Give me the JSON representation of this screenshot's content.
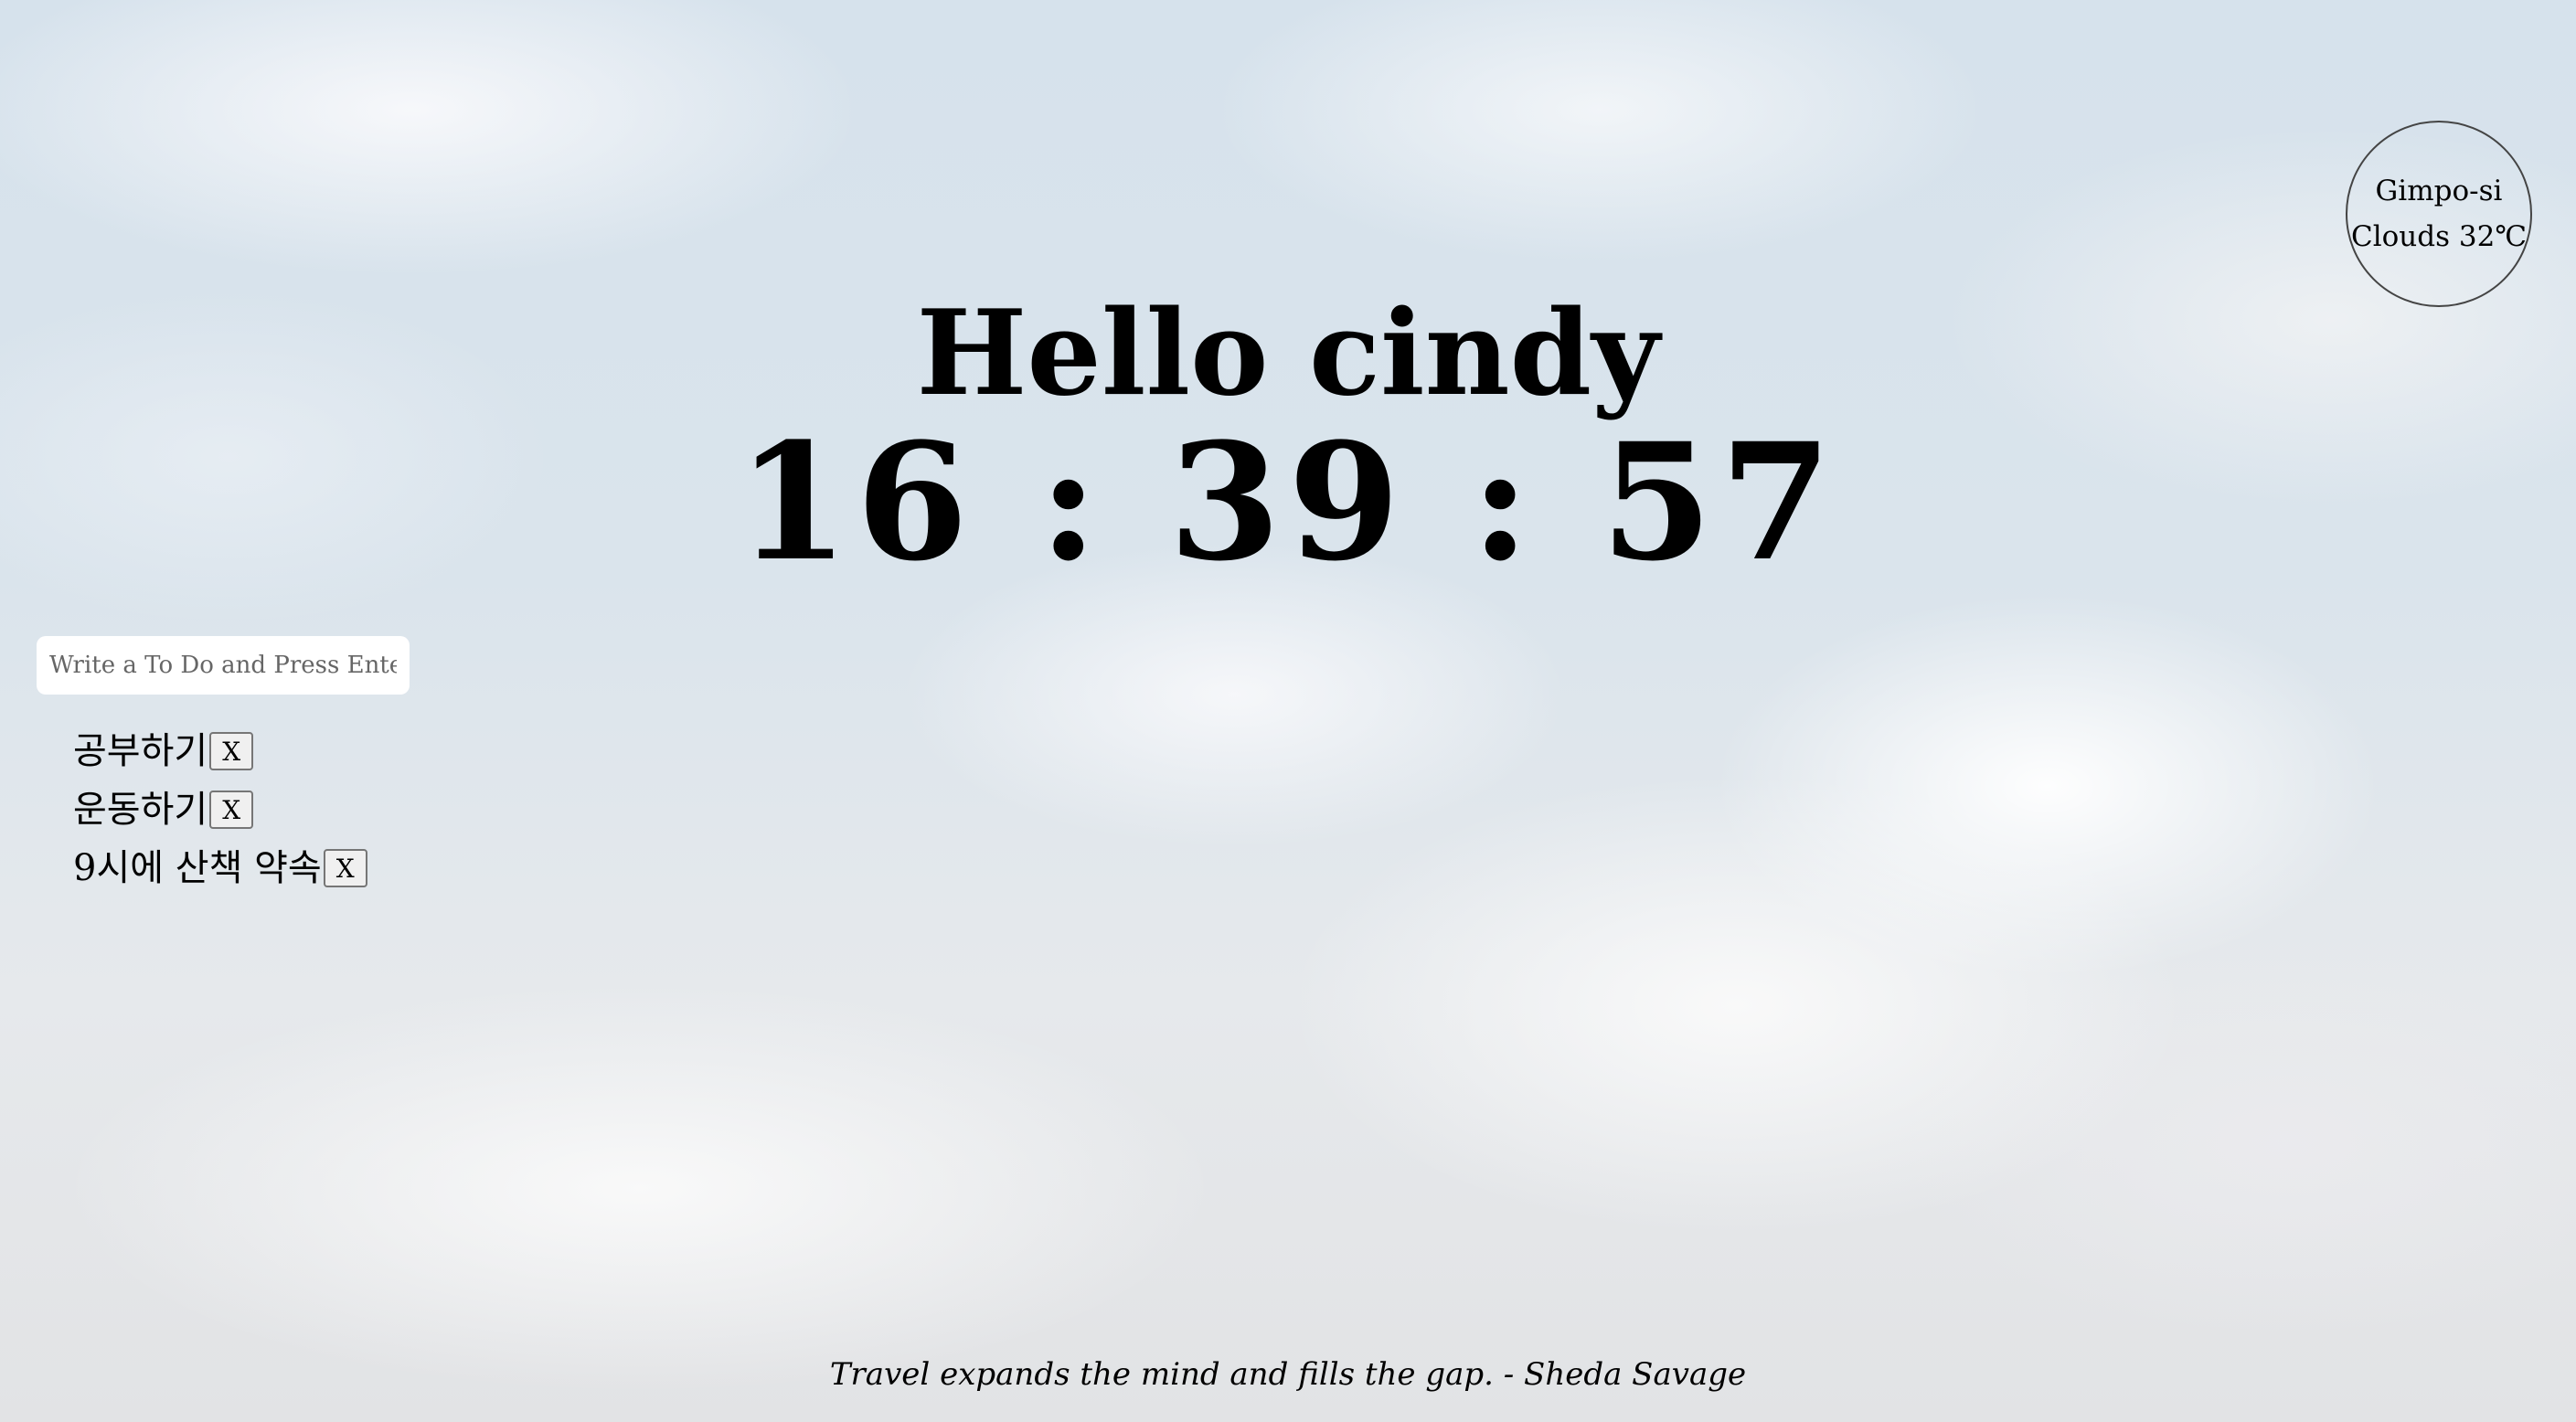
{
  "weather": {
    "city": "Gimpo-si",
    "condition": "Clouds 32℃"
  },
  "greeting": "Hello cindy",
  "clock": "16 : 39 : 57",
  "todo": {
    "placeholder": "Write a To Do and Press Enter",
    "items": [
      {
        "text": "공부하기",
        "delete_label": "X"
      },
      {
        "text": "운동하기",
        "delete_label": "X"
      },
      {
        "text": "9시에 산책 약속",
        "delete_label": "X"
      }
    ]
  },
  "quote": "Travel expands the mind and fills the gap. - Sheda Savage"
}
